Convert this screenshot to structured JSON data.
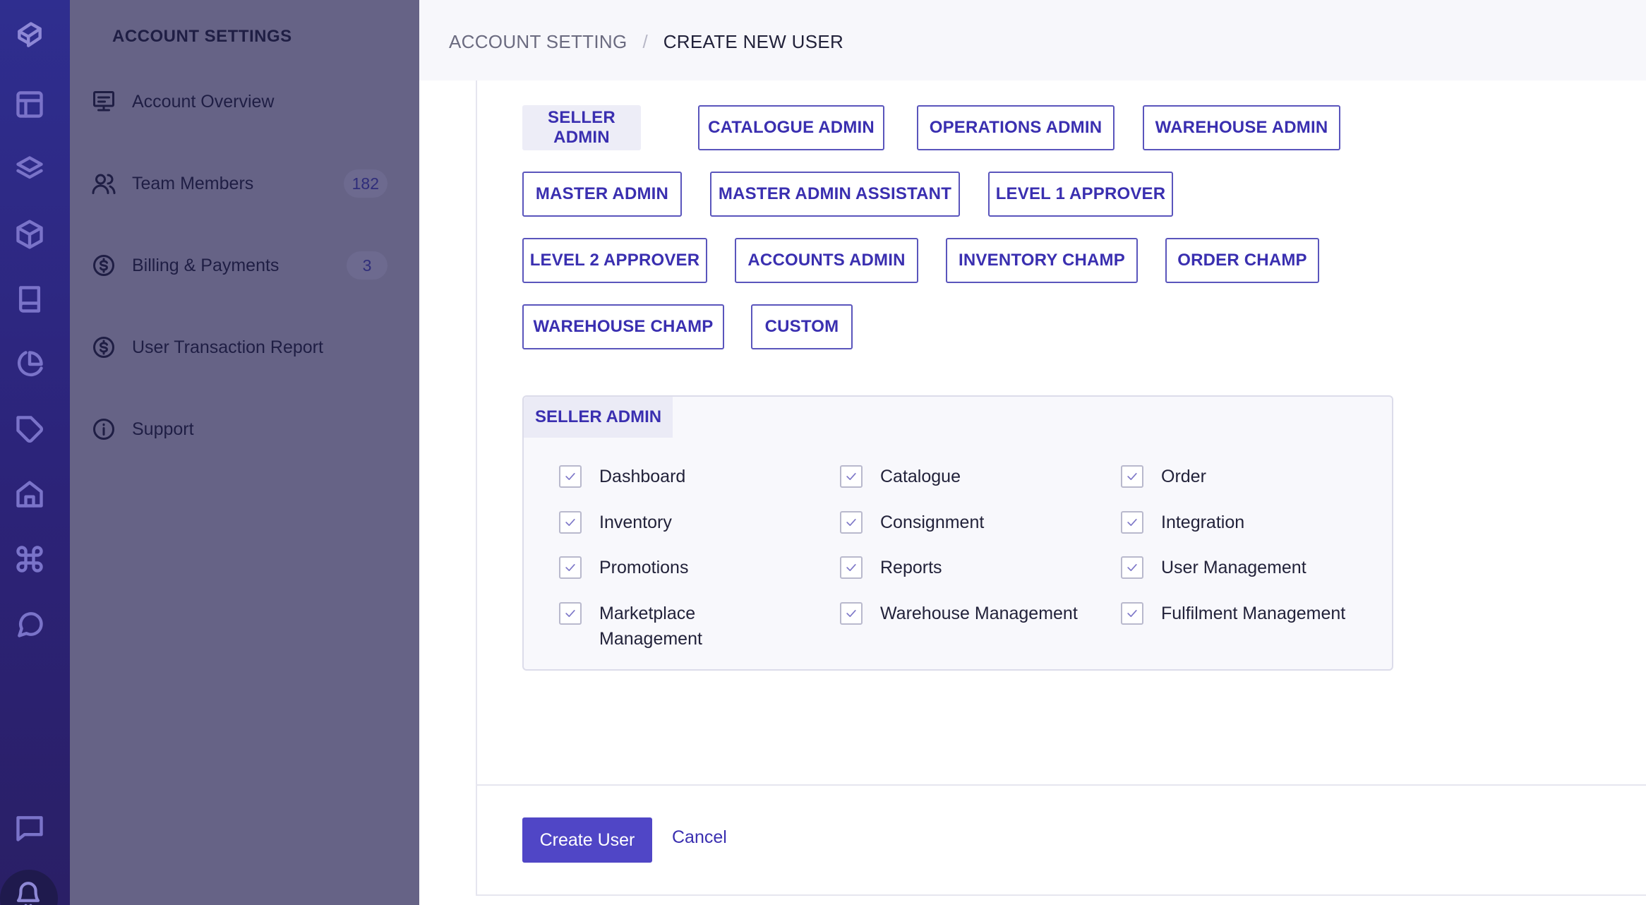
{
  "rail": {
    "icons": [
      "logo-icon",
      "layout-icon",
      "layers-icon",
      "box-icon",
      "book-icon",
      "pie-chart-icon",
      "tag-icon",
      "home-icon",
      "command-icon",
      "chat-bubble-icon",
      "message-square-icon",
      "bell-icon"
    ]
  },
  "sidebar": {
    "title": "ACCOUNT SETTINGS",
    "items": [
      {
        "label": "Account Overview",
        "icon": "monitor-icon",
        "count": ""
      },
      {
        "label": "Team Members",
        "icon": "users-icon",
        "count": "182"
      },
      {
        "label": "Billing & Payments",
        "icon": "dollar-circle-icon",
        "count": "3"
      },
      {
        "label": "User Transaction Report",
        "icon": "dollar-circle-icon",
        "count": ""
      },
      {
        "label": "Support",
        "icon": "info-icon",
        "count": ""
      }
    ]
  },
  "breadcrumb": {
    "parent": "ACCOUNT SETTING",
    "current": "CREATE NEW USER"
  },
  "roles": {
    "selected": "SELLER ADMIN",
    "items": [
      "SELLER ADMIN",
      "CATALOGUE ADMIN",
      "OPERATIONS ADMIN",
      "WAREHOUSE ADMIN",
      "MASTER ADMIN",
      "MASTER ADMIN ASSISTANT",
      "LEVEL 1 APPROVER",
      "LEVEL 2 APPROVER",
      "ACCOUNTS ADMIN",
      "INVENTORY CHAMP",
      "ORDER CHAMP",
      "WAREHOUSE CHAMP",
      "CUSTOM"
    ]
  },
  "permissions": {
    "tab_label": "SELLER ADMIN",
    "items": [
      {
        "label": "Dashboard",
        "checked": true
      },
      {
        "label": "Catalogue",
        "checked": true
      },
      {
        "label": "Order",
        "checked": true
      },
      {
        "label": "Inventory",
        "checked": true
      },
      {
        "label": "Consignment",
        "checked": true
      },
      {
        "label": "Integration",
        "checked": true
      },
      {
        "label": "Promotions",
        "checked": true
      },
      {
        "label": "Reports",
        "checked": true
      },
      {
        "label": "User Management",
        "checked": true
      },
      {
        "label": "Marketplace Management",
        "checked": true
      },
      {
        "label": "Warehouse Management",
        "checked": true
      },
      {
        "label": "Fulfilment Management",
        "checked": true
      }
    ]
  },
  "actions": {
    "create_label": "Create User",
    "cancel_label": "Cancel"
  },
  "colors": {
    "accent": "#5046c6",
    "rail_bg": "#2c2378",
    "sidebar_bg": "#666386"
  }
}
